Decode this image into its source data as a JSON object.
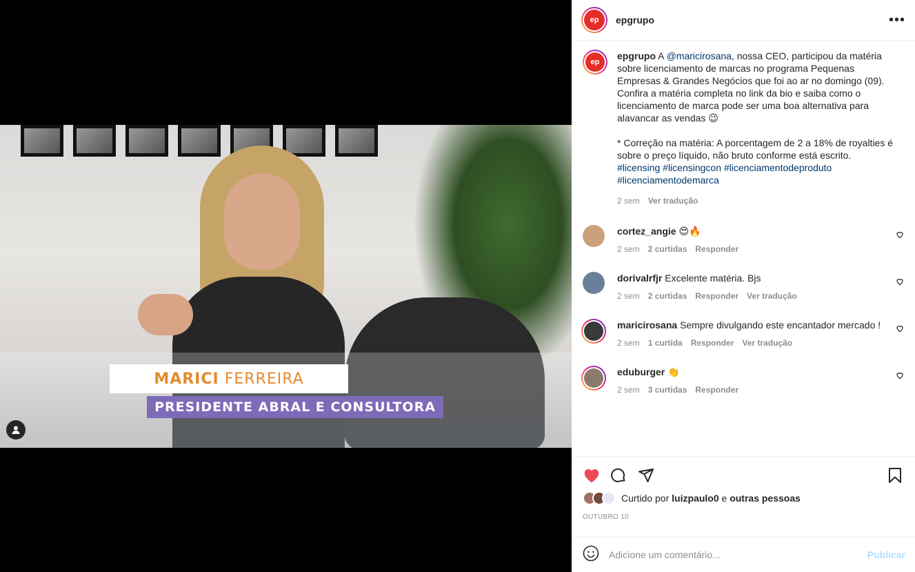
{
  "media": {
    "lower_third_first": "MARICI",
    "lower_third_last": "FERREIRA",
    "lower_third_role": "PRESIDENTE ABRAL E CONSULTORA"
  },
  "header": {
    "logo_text": "ep",
    "username": "epgrupo",
    "more_label": "•••"
  },
  "caption": {
    "username": "epgrupo",
    "text_before": " A ",
    "mention": "@maricirosana",
    "text_after": ", nossa CEO, participou da matéria sobre licenciamento de marcas no programa Pequenas Empresas & Grandes Negócios que foi ao ar no domingo (09). Confira a matéria completa no link da bio e saiba como o licenciamento de marca pode ser uma boa alternativa para alavancar as vendas 😉",
    "correction": "* Correção na matéria: A porcentagem de 2 a 18% de royalties é sobre o preço líquido, não bruto conforme está escrito.",
    "hashtags": "#licensing #licensingcon #licenciamentodeproduto #licenciamentodemarca",
    "time": "2 sem",
    "translate": "Ver tradução"
  },
  "comments": [
    {
      "username": "cortez_angie",
      "text": "😍🔥",
      "time": "2 sem",
      "likes": "2 curtidas",
      "reply": "Responder",
      "translate": "",
      "avatar_color": "#c9a27a"
    },
    {
      "username": "dorivalrfjr",
      "text": "Excelente matéria. Bjs",
      "time": "2 sem",
      "likes": "2 curtidas",
      "reply": "Responder",
      "translate": "Ver tradução",
      "avatar_color": "#6a7f9a"
    },
    {
      "username": "maricirosana",
      "text": "Sempre divulgando este encantador mercado !",
      "time": "2 sem",
      "likes": "1 curtida",
      "reply": "Responder",
      "translate": "Ver tradução",
      "avatar_color": "#3a3a3a"
    },
    {
      "username": "eduburger",
      "text": "👏",
      "time": "2 sem",
      "likes": "3 curtidas",
      "reply": "Responder",
      "translate": "",
      "avatar_color": "#8a7a6a"
    }
  ],
  "actions": {
    "liked_prefix": "Curtido por ",
    "liked_user": "luizpaulo0",
    "liked_and": " e ",
    "liked_others": "outras pessoas",
    "date": "OUTUBRO 10",
    "like_color": "#ed4956"
  },
  "composer": {
    "placeholder": "Adicione um comentário...",
    "publish": "Publicar"
  }
}
